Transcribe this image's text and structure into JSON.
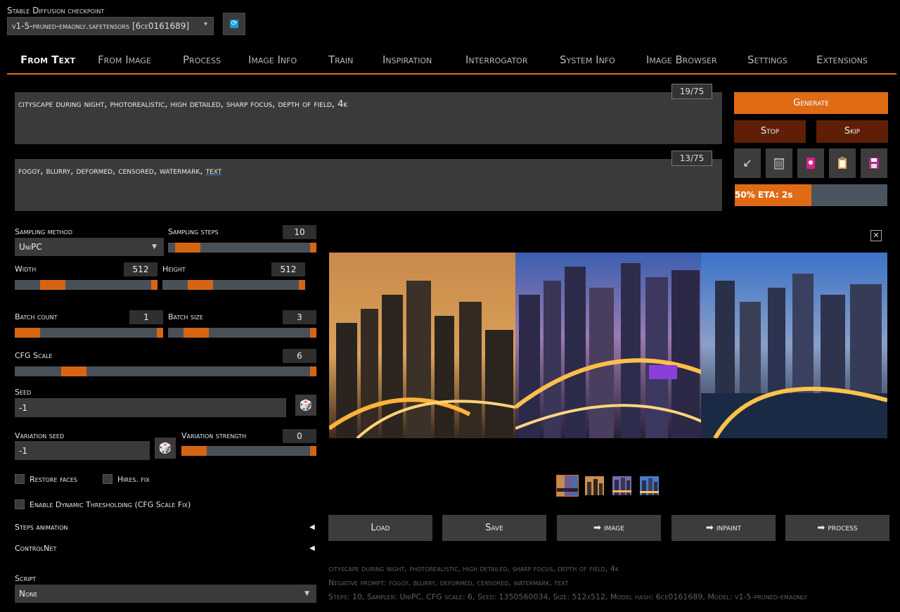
{
  "header": {
    "checkpoint_label": "Stable Diffusion checkpoint",
    "checkpoint_value": "v1-5-pruned-emaonly.safetensors [6ce0161689]",
    "refresh_icon": "refresh-icon"
  },
  "tabs": [
    {
      "label": "From Text",
      "active": true
    },
    {
      "label": "From Image"
    },
    {
      "label": "Process"
    },
    {
      "label": "Image Info"
    },
    {
      "label": "Train"
    },
    {
      "label": "Inspiration"
    },
    {
      "label": "Interrogator"
    },
    {
      "label": "System Info"
    },
    {
      "label": "Image Browser"
    },
    {
      "label": "Settings"
    },
    {
      "label": "Extensions"
    }
  ],
  "prompt": {
    "text": "cityscape during night, photorealistic, high detailed, sharp focus, depth of field, 4k",
    "counter": "19/75"
  },
  "negative_prompt": {
    "text_main": "foggy, blurry, deformed, censored, watermark, ",
    "text_underlined": "text",
    "counter": "13/75"
  },
  "actions": {
    "generate": "Generate",
    "stop": "Stop",
    "skip": "Skip",
    "tools": [
      "arrow-icon",
      "trash-icon",
      "style-icon",
      "clipboard-icon",
      "save-icon"
    ]
  },
  "progress": {
    "label": "50% ETA: 2s",
    "value": 0.5
  },
  "params": {
    "sampling_method_label": "Sampling method",
    "sampling_method_value": "UniPC",
    "sampling_steps_label": "Sampling steps",
    "sampling_steps_value": "10",
    "width_label": "Width",
    "width_value": "512",
    "height_label": "Height",
    "height_value": "512",
    "batch_count_label": "Batch count",
    "batch_count_value": "1",
    "batch_size_label": "Batch size",
    "batch_size_value": "3",
    "cfg_label": "CFG Scale",
    "cfg_value": "6",
    "seed_label": "Seed",
    "seed_value": "-1",
    "var_seed_label": "Variation seed",
    "var_seed_value": "-1",
    "var_strength_label": "Variation strength",
    "var_strength_value": "0",
    "restore_faces": "Restore faces",
    "hires_fix": "Hires. fix",
    "dynamic_thresholding": "Enable Dynamic Thresholding (CFG Scale Fix)",
    "steps_animation": "Steps animation",
    "controlnet": "ControlNet",
    "script_label": "Script",
    "script_value": "None"
  },
  "output": {
    "buttons": {
      "load": "Load",
      "save": "Save",
      "image": "➡ image",
      "inpaint": "➡ inpaint",
      "process": "➡ process"
    },
    "info_lines": [
      "cityscape during night, photorealistic, high detailed, sharp focus, depth of field, 4k",
      "Negative prompt: foggy, blurry, deformed, censored, watermark, text",
      "Steps: 10, Sampler: UniPC, CFG scale: 6, Seed: 1350560034, Size: 512x512, Model hash: 6ce0161689, Model: v1-5-pruned-emaonly"
    ]
  },
  "colors": {
    "accent": "#e06b15",
    "dark_button": "#5e1f06",
    "track": "#4a5058"
  }
}
